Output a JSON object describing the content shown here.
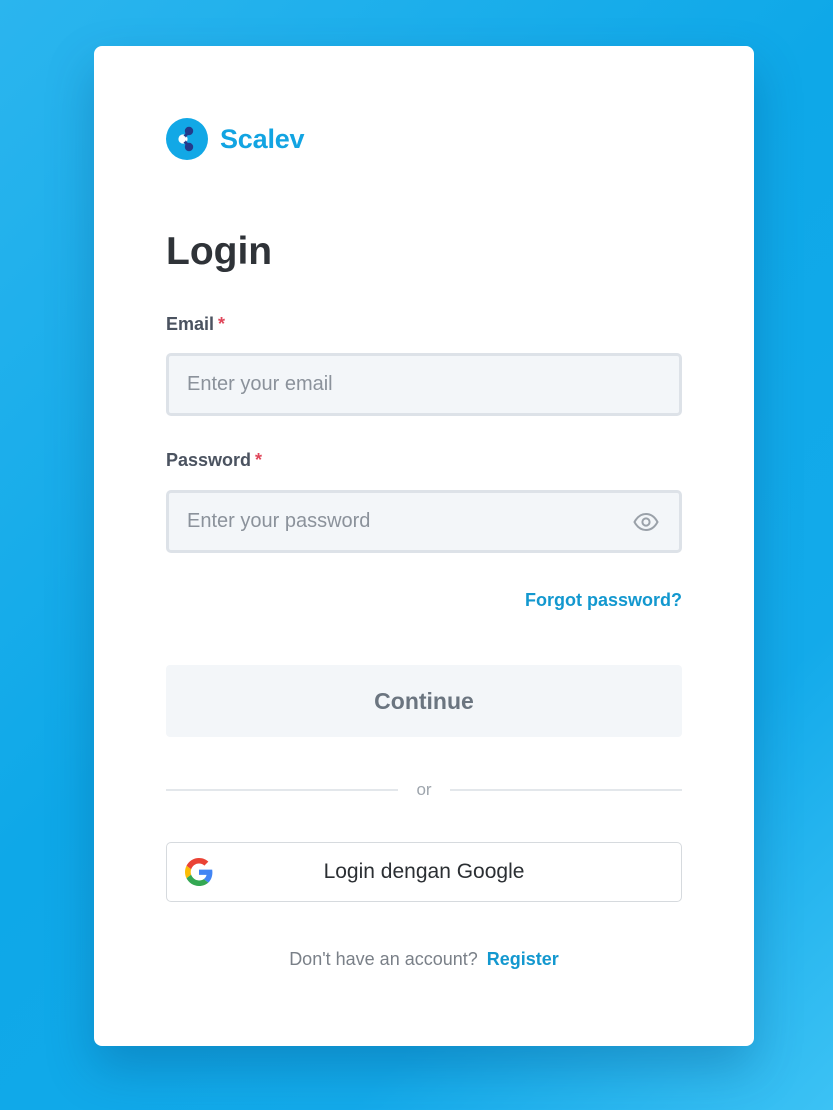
{
  "brand": {
    "name": "Scalev"
  },
  "page": {
    "title": "Login"
  },
  "form": {
    "email": {
      "label": "Email",
      "required_mark": "*",
      "placeholder": "Enter your email",
      "value": ""
    },
    "password": {
      "label": "Password",
      "required_mark": "*",
      "placeholder": "Enter your password",
      "value": ""
    },
    "forgot_label": "Forgot password?",
    "continue_label": "Continue",
    "divider_label": "or",
    "google_label": "Login dengan Google"
  },
  "footer": {
    "prompt": "Don't have an account?",
    "register_label": "Register"
  },
  "colors": {
    "brand": "#12a4e2",
    "link": "#1398cf",
    "required": "#e0465a",
    "background": "#0ea8e8"
  },
  "icons": {
    "logo": "scalev-logo-icon",
    "eye": "eye-icon",
    "google": "google-icon"
  }
}
